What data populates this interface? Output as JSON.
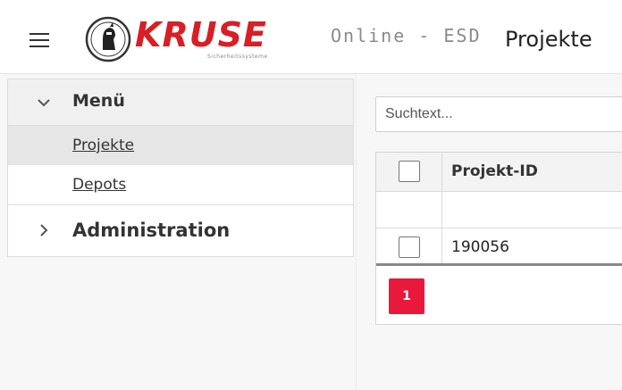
{
  "header": {
    "brand": "KRUSE",
    "brand_tagline": "Sicherheitssysteme",
    "app_subtitle": "Online - ESD",
    "page_title": "Projekte"
  },
  "sidebar": {
    "menu_label": "Menü",
    "items": [
      {
        "label": "Projekte",
        "active": true
      },
      {
        "label": "Depots",
        "active": false
      }
    ],
    "admin_label": "Administration"
  },
  "search": {
    "placeholder": "Suchtext..."
  },
  "table": {
    "columns": [
      "Projekt-ID"
    ],
    "rows": [
      {
        "id": "190056"
      }
    ]
  },
  "pagination": {
    "current_page": "1"
  },
  "colors": {
    "brand_red": "#d81f26",
    "pager_red": "#e8193c"
  }
}
